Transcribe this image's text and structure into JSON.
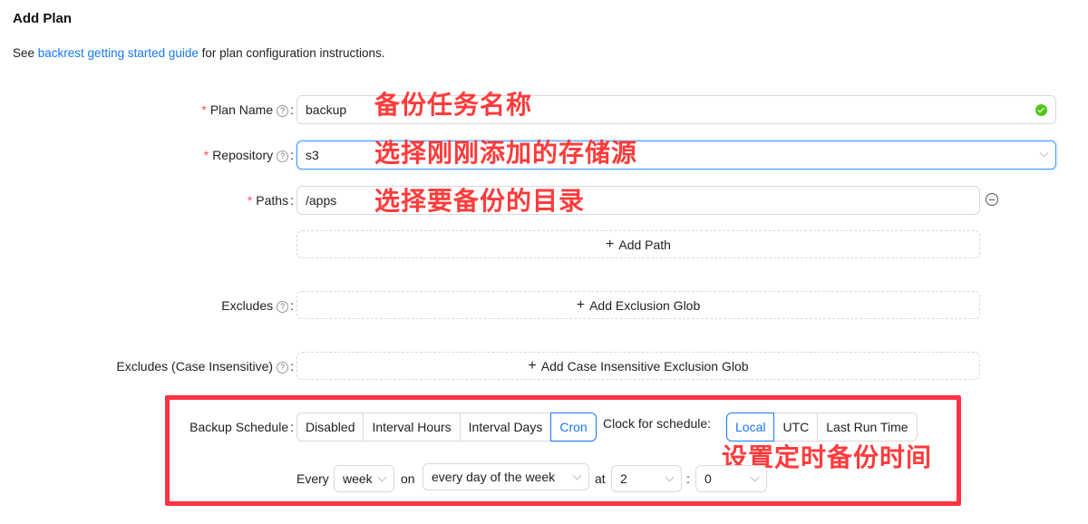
{
  "page": {
    "title": "Add Plan",
    "intro_prefix": "See ",
    "intro_link": "backrest getting started guide",
    "intro_suffix": " for plan configuration instructions."
  },
  "form": {
    "plan_name": {
      "label": "Plan Name",
      "required_mark": "*",
      "value": "backup"
    },
    "repository": {
      "label": "Repository",
      "required_mark": "*",
      "value": "s3"
    },
    "paths": {
      "label": "Paths",
      "required_mark": "*",
      "value": "/apps",
      "add_label": "Add Path"
    },
    "excludes": {
      "label": "Excludes",
      "add_label": "Add Exclusion Glob"
    },
    "excludes_ci": {
      "label": "Excludes (Case Insensitive)",
      "add_label": "Add Case Insensitive Exclusion Glob"
    },
    "schedule": {
      "label": "Backup Schedule",
      "options": [
        "Disabled",
        "Interval Hours",
        "Interval Days",
        "Cron"
      ],
      "selected": "Cron",
      "clock_label": "Clock for schedule:",
      "clock_options": [
        "Local",
        "UTC",
        "Last Run Time"
      ],
      "clock_selected": "Local",
      "every_label": "Every",
      "period": "week",
      "on_label": "on",
      "day": "every day of the week",
      "at_label": "at",
      "hour": "2",
      "sep": ":",
      "minute": "0"
    }
  },
  "annotations": {
    "plan_name": "备份任务名称",
    "repository": "选择刚刚添加的存储源",
    "paths": "选择要备份的目录",
    "schedule": "设置定时备份时间"
  },
  "help_glyph": "?",
  "colon": ":",
  "plus_glyph": "+",
  "colors": {
    "accent": "#1677ff",
    "required": "#ff4d4f",
    "annotation": "#ff3b3b",
    "highlight_box": "#ff3344",
    "valid": "#52c41a"
  }
}
